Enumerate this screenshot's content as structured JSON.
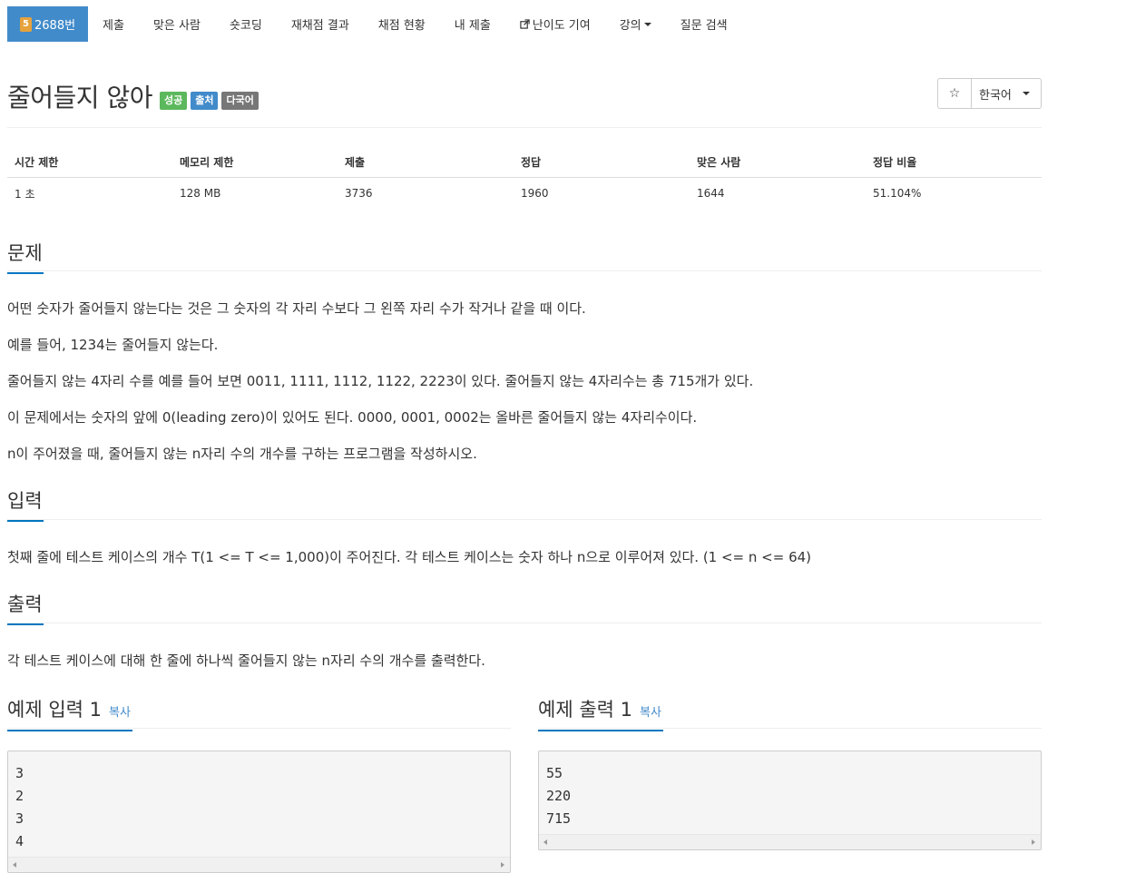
{
  "nav": {
    "problem_number": "2688번",
    "problem_badge": "5",
    "items": [
      "제출",
      "맞은 사람",
      "숏코딩",
      "재채점 결과",
      "채점 현황",
      "내 제출",
      "난이도 기여",
      "강의",
      "질문 검색"
    ]
  },
  "title": {
    "text": "줄어들지 않아",
    "labels": [
      "성공",
      "출처",
      "다국어"
    ],
    "star": "☆",
    "language": "한국어"
  },
  "info": {
    "headers": [
      "시간 제한",
      "메모리 제한",
      "제출",
      "정답",
      "맞은 사람",
      "정답 비율"
    ],
    "values": [
      "1 초",
      "128 MB",
      "3736",
      "1960",
      "1644",
      "51.104%"
    ]
  },
  "sections": {
    "problem": {
      "heading": "문제",
      "paragraphs": [
        "어떤 숫자가 줄어들지 않는다는 것은 그 숫자의 각 자리 수보다 그 왼쪽 자리 수가 작거나 같을 때 이다.",
        "예를 들어, 1234는 줄어들지 않는다.",
        "줄어들지 않는 4자리 수를 예를 들어 보면 0011, 1111, 1112, 1122, 2223이 있다. 줄어들지 않는 4자리수는 총 715개가 있다.",
        "이 문제에서는 숫자의 앞에 0(leading zero)이 있어도 된다. 0000, 0001, 0002는 올바른 줄어들지 않는 4자리수이다.",
        "n이 주어졌을 때, 줄어들지 않는 n자리 수의 개수를 구하는 프로그램을 작성하시오."
      ]
    },
    "input": {
      "heading": "입력",
      "text": "첫째 줄에 테스트 케이스의 개수 T(1 <= T <= 1,000)이 주어진다. 각 테스트 케이스는 숫자 하나 n으로 이루어져 있다. (1 <= n <= 64)"
    },
    "output": {
      "heading": "출력",
      "text": "각 테스트 케이스에 대해 한 줄에 하나씩 줄어들지 않는 n자리 수의 개수를 출력한다."
    }
  },
  "samples": {
    "input_heading": "예제 입력 1",
    "output_heading": "예제 출력 1",
    "copy_label": "복사",
    "input_text": "3\n2\n3\n4",
    "output_text": "55\n220\n715"
  },
  "colors": {
    "nav_active": "#428bca",
    "label_success": "#5cb85c",
    "label_primary": "#428bca",
    "label_default": "#777777",
    "accent_underline": "#0076c0"
  }
}
